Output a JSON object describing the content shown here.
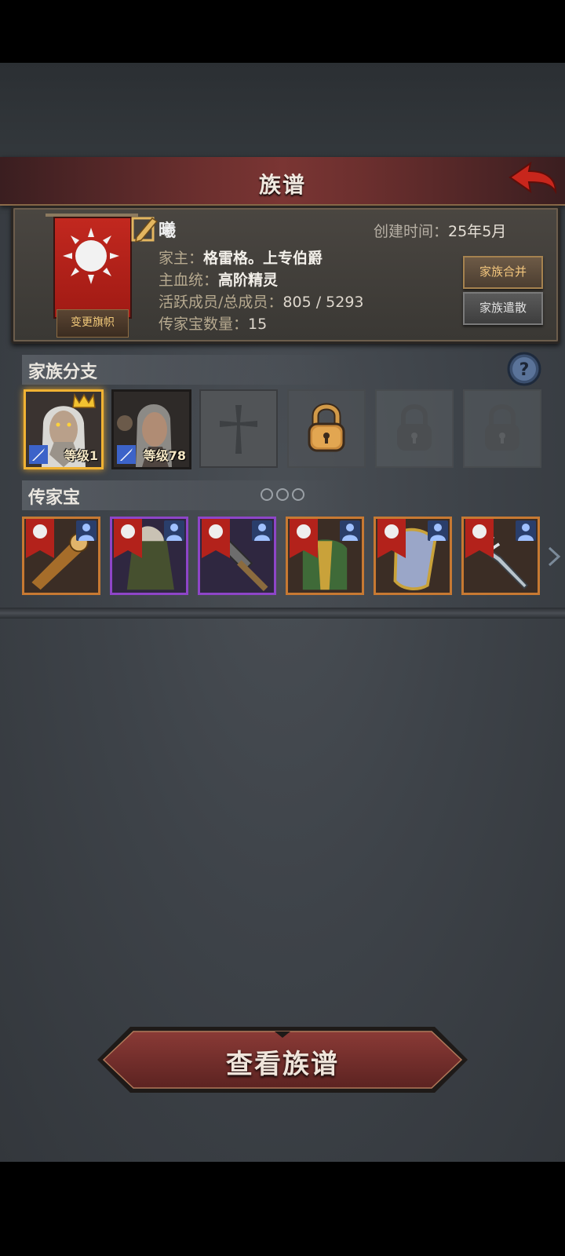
{
  "header": {
    "title": "族谱",
    "back_icon": "back-arrow-icon"
  },
  "clan": {
    "name": "曦",
    "created_label": "创建时间：",
    "created_value": "25年5月",
    "leader_label": "家主：",
    "leader_value": "格雷格。上专伯爵",
    "bloodline_label": "主血统：",
    "bloodline_value": "高阶精灵",
    "members_label": "活跃成员/总成员：",
    "members_value": "805 / 5293",
    "heirloom_count_label": "传家宝数量：",
    "heirloom_count_value": "15",
    "change_flag_label": "变更旗帜",
    "merge_label": "家族合并",
    "disband_label": "家族遣散",
    "banner_color": "#b3221b"
  },
  "branches": {
    "title": "家族分支",
    "help_icon": "question-icon",
    "members": [
      {
        "level_text": "等级1",
        "selected": true,
        "crown": true
      },
      {
        "level_text": "等级78",
        "selected": false,
        "crown": false
      }
    ],
    "empty_slot_icon": "cross-icon",
    "unlockable_slot_icon": "padlock-icon",
    "locked_slot_icon": "padlock-icon"
  },
  "heirlooms": {
    "title": "传家宝",
    "items": [
      {
        "kind": "staff",
        "rarity": "orange"
      },
      {
        "kind": "cloak",
        "rarity": "purple"
      },
      {
        "kind": "hammer",
        "rarity": "purple"
      },
      {
        "kind": "armor",
        "rarity": "orange"
      },
      {
        "kind": "shield",
        "rarity": "orange"
      },
      {
        "kind": "trident",
        "rarity": "orange"
      }
    ],
    "rarity_colors": {
      "orange": "#c77932",
      "purple": "#8e45c8"
    }
  },
  "footer": {
    "view_tree_label": "查看族谱"
  }
}
